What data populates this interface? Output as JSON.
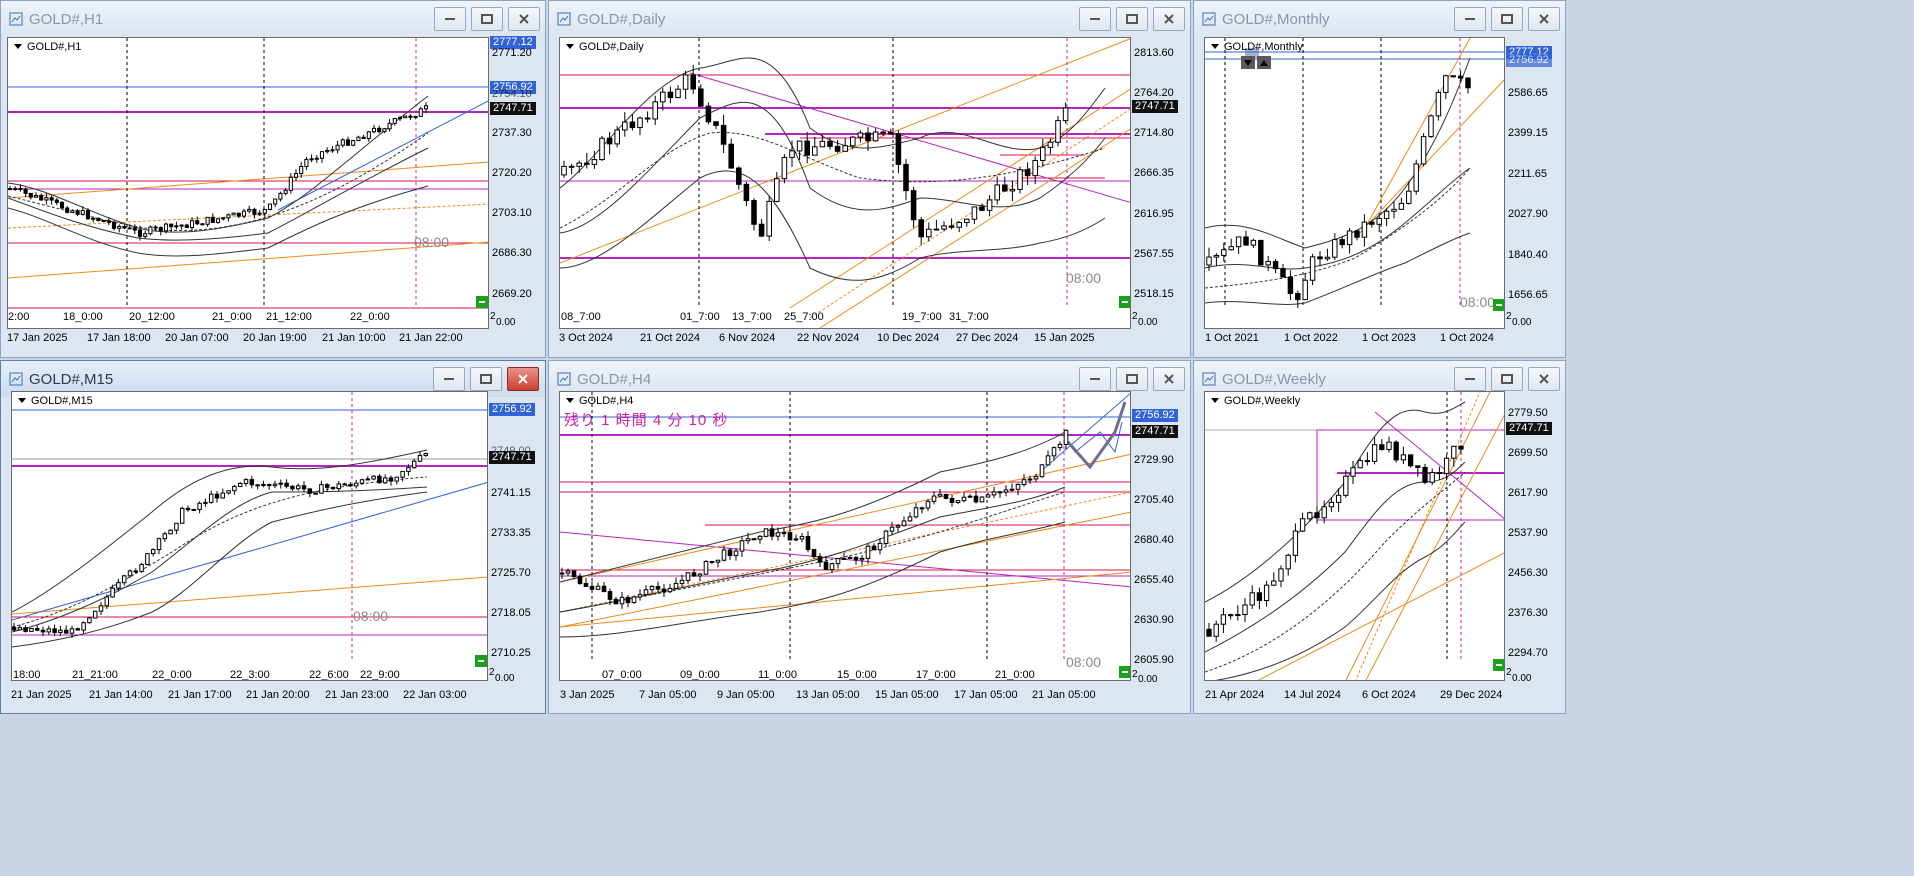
{
  "windows": [
    {
      "title": "GOLD#,H1",
      "symbol": "GOLD#,H1",
      "prices": [
        "2771.20",
        "2754.10",
        "2737.30",
        "2720.20",
        "2703.10",
        "2686.30",
        "2669.20"
      ],
      "tags": [
        {
          "text": "2777.12",
          "color": "blue"
        },
        {
          "text": "2756.92",
          "color": "blue"
        },
        {
          "text": "2747.71",
          "color": "dark"
        }
      ],
      "dateline": [
        "2:00",
        "18_0:00",
        "20_12:00",
        "21_0:00",
        "21_12:00",
        "22_0:00"
      ],
      "timeaxis": [
        "17 Jan 2025",
        "17 Jan 18:00",
        "20 Jan 07:00",
        "20 Jan 19:00",
        "21 Jan 10:00",
        "21 Jan 22:00"
      ],
      "session": "08:00",
      "indicator": "2",
      "zero": "0.00"
    },
    {
      "title": "GOLD#,Daily",
      "symbol": "GOLD#,Daily",
      "prices": [
        "2813.60",
        "2764.20",
        "2714.80",
        "2666.35",
        "2616.95",
        "2567.55",
        "2518.15"
      ],
      "tags": [
        {
          "text": "2747.71",
          "color": "dark"
        }
      ],
      "dateline": [
        "08_7:00",
        "01_7:00",
        "13_7:00",
        "25_7:00",
        "19_7:00",
        "31_7:00"
      ],
      "timeaxis": [
        "3 Oct 2024",
        "21 Oct 2024",
        "6 Nov 2024",
        "22 Nov 2024",
        "10 Dec 2024",
        "27 Dec 2024",
        "15 Jan 2025"
      ],
      "session": "08:00",
      "indicator": "2",
      "zero": "0.00"
    },
    {
      "title": "GOLD#,Monthly",
      "symbol": "GOLD#,Monthly",
      "prices": [
        "2586.65",
        "2399.15",
        "2211.65",
        "2027.90",
        "1840.40",
        "1656.65"
      ],
      "tags": [
        {
          "text": "2777.12",
          "color": "blue"
        },
        {
          "text": "2756.92",
          "color": "blue"
        }
      ],
      "dateline": [],
      "timeaxis": [
        "1 Oct 2021",
        "1 Oct 2022",
        "1 Oct 2023",
        "1 Oct 2024"
      ],
      "session": "08:00",
      "indicator": "2",
      "zero": "0.00"
    },
    {
      "title": "GOLD#,M15",
      "symbol": "GOLD#,M15",
      "prices": [
        "2749.00",
        "2741.15",
        "2733.35",
        "2725.70",
        "2718.05",
        "2710.25"
      ],
      "tags": [
        {
          "text": "2756.92",
          "color": "blue"
        },
        {
          "text": "2747.71",
          "color": "dark"
        }
      ],
      "dateline": [
        "18:00",
        "21_21:00",
        "22_0:00",
        "22_3:00",
        "22_6:00",
        "22_9:00"
      ],
      "timeaxis": [
        "21 Jan 2025",
        "21 Jan 14:00",
        "21 Jan 17:00",
        "21 Jan 20:00",
        "21 Jan 23:00",
        "22 Jan 03:00"
      ],
      "session": "08:00",
      "indicator": "2",
      "zero": "0.00"
    },
    {
      "title": "GOLD#,H4",
      "symbol": "GOLD#,H4",
      "timer": "残り 1 時間 4 分 10 秒",
      "prices": [
        "2729.90",
        "2705.40",
        "2680.40",
        "2655.40",
        "2630.90",
        "2605.90"
      ],
      "tags": [
        {
          "text": "2756.92",
          "color": "blue"
        },
        {
          "text": "2747.71",
          "color": "dark"
        }
      ],
      "dateline": [
        "07_0:00",
        "09_0:00",
        "11_0:00",
        "15_0:00",
        "17_0:00",
        "21_0:00"
      ],
      "timeaxis": [
        "3 Jan 2025",
        "7 Jan 05:00",
        "9 Jan 05:00",
        "13 Jan 05:00",
        "15 Jan 05:00",
        "17 Jan 05:00",
        "21 Jan 05:00"
      ],
      "session": "08:00",
      "indicator": "2",
      "zero": "0.00"
    },
    {
      "title": "GOLD#,Weekly",
      "symbol": "GOLD#,Weekly",
      "prices": [
        "2779.50",
        "2699.50",
        "2617.90",
        "2537.90",
        "2456.30",
        "2376.30",
        "2294.70"
      ],
      "tags": [
        {
          "text": "2747.71",
          "color": "dark"
        }
      ],
      "dateline": [],
      "timeaxis": [
        "21 Apr 2024",
        "14 Jul 2024",
        "6 Oct 2024",
        "29 Dec 2024"
      ],
      "session": "",
      "indicator": "2",
      "zero": "0.00"
    }
  ]
}
